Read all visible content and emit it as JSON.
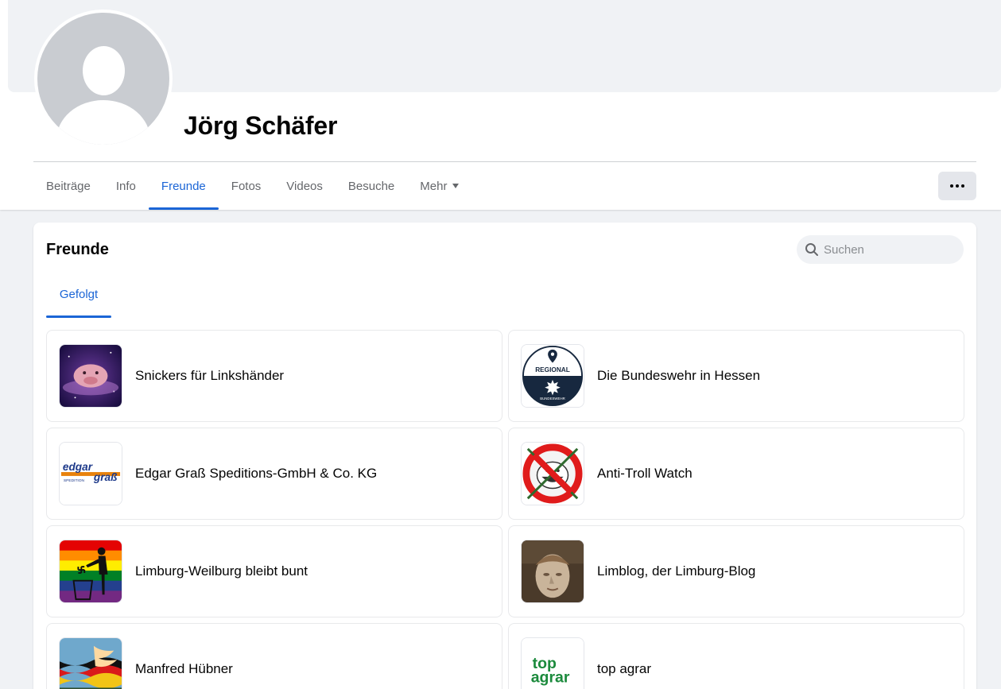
{
  "profile": {
    "name": "Jörg Schäfer"
  },
  "tabs": [
    {
      "label": "Beiträge",
      "active": false
    },
    {
      "label": "Info",
      "active": false
    },
    {
      "label": "Freunde",
      "active": true
    },
    {
      "label": "Fotos",
      "active": false
    },
    {
      "label": "Videos",
      "active": false
    },
    {
      "label": "Besuche",
      "active": false
    },
    {
      "label": "Mehr",
      "active": false
    }
  ],
  "section": {
    "title": "Freunde",
    "search_placeholder": "Suchen",
    "subtab": "Gefolgt"
  },
  "followed": [
    {
      "name": "Snickers für Linkshänder",
      "icon": "blobfish-image"
    },
    {
      "name": "Die Bundeswehr in Hessen",
      "icon": "bundeswehr-regional-logo",
      "logo_text": [
        "REGIONAL",
        "BUNDESWEHR"
      ]
    },
    {
      "name": "Edgar Graß Speditions-GmbH & Co. KG",
      "icon": "edgar-grass-logo",
      "logo_text": [
        "edgar",
        "graß",
        "SPEDITION"
      ]
    },
    {
      "name": "Anti-Troll Watch",
      "icon": "no-troll-icon"
    },
    {
      "name": "Limburg-Weilburg bleibt bunt",
      "icon": "rainbow-trash-icon"
    },
    {
      "name": "Limblog, der Limburg-Blog",
      "icon": "statue-head-image"
    },
    {
      "name": "Manfred Hübner",
      "icon": "flag-phoenix-image"
    },
    {
      "name": "top agrar",
      "icon": "top-agrar-logo",
      "logo_text": [
        "top",
        "agrar"
      ]
    }
  ],
  "colors": {
    "accent": "#1b65d6",
    "background": "#f0f2f5",
    "text": "#050505",
    "muted": "#65676b"
  }
}
